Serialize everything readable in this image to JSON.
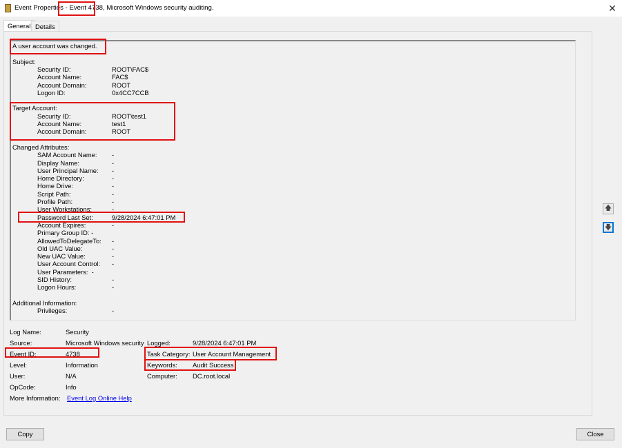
{
  "window": {
    "title": "Event Properties - Event 4738, Microsoft Windows security auditing.",
    "close": "✕"
  },
  "tabs": [
    {
      "label": "General"
    },
    {
      "label": "Details"
    }
  ],
  "description": [
    {
      "text": "A user account was changed."
    },
    {
      "text": ""
    },
    {
      "text": "Subject:"
    },
    {
      "label": "Security ID:",
      "value": "ROOT\\FAC$"
    },
    {
      "label": "Account Name:",
      "value": "FAC$"
    },
    {
      "label": "Account Domain:",
      "value": "ROOT"
    },
    {
      "label": "Logon ID:",
      "value": "0x4CC7CCB"
    },
    {
      "text": ""
    },
    {
      "text": "Target Account:"
    },
    {
      "label": "Security ID:",
      "value": "ROOT\\test1"
    },
    {
      "label": "Account Name:",
      "value": "test1"
    },
    {
      "label": "Account Domain:",
      "value": "ROOT"
    },
    {
      "text": ""
    },
    {
      "text": "Changed Attributes:"
    },
    {
      "label": "SAM Account Name:",
      "value": "-"
    },
    {
      "label": "Display Name:",
      "value": "-"
    },
    {
      "label": "User Principal Name:",
      "value": "-"
    },
    {
      "label": "Home Directory:",
      "value": "-"
    },
    {
      "label": "Home Drive:",
      "value": "-"
    },
    {
      "label": "Script Path:",
      "value": "-"
    },
    {
      "label": "Profile Path:",
      "value": "-"
    },
    {
      "label": "User Workstations:",
      "value": "-"
    },
    {
      "label": "Password Last Set:",
      "value": "9/28/2024 6:47:01 PM"
    },
    {
      "label": "Account Expires:",
      "value": "-"
    },
    {
      "label": "Primary Group ID: -",
      "value": ""
    },
    {
      "label": "AllowedToDelegateTo:",
      "value": "-"
    },
    {
      "label": "Old UAC Value:",
      "value": "-"
    },
    {
      "label": "New UAC Value:",
      "value": "-"
    },
    {
      "label": "User Account Control:",
      "value": "-"
    },
    {
      "label": "User Parameters:  -",
      "value": ""
    },
    {
      "label": "SID History:",
      "value": "-"
    },
    {
      "label": "Logon Hours:",
      "value": "-"
    },
    {
      "text": ""
    },
    {
      "text": "Additional Information:"
    },
    {
      "label": "Privileges:",
      "value": "-"
    }
  ],
  "fields": {
    "log_name": {
      "label": "Log Name:",
      "value": "Security"
    },
    "source": {
      "label": "Source:",
      "value": "Microsoft Windows security"
    },
    "event_id": {
      "label": "Event ID:",
      "value": "4738"
    },
    "level": {
      "label": "Level:",
      "value": "Information"
    },
    "user": {
      "label": "User:",
      "value": "N/A"
    },
    "opcode": {
      "label": "OpCode:",
      "value": "Info"
    },
    "more_info": {
      "label": "More Information:",
      "value": "Event Log Online Help"
    },
    "logged": {
      "label": "Logged:",
      "value": "9/28/2024 6:47:01 PM"
    },
    "task_category": {
      "label": "Task Category:",
      "value": "User Account Management"
    },
    "keywords": {
      "label": "Keywords:",
      "value": "Audit Success"
    },
    "computer": {
      "label": "Computer:",
      "value": "DC.root.local"
    }
  },
  "buttons": {
    "copy": "Copy",
    "close": "Close",
    "up": "🡅",
    "down": "🡇"
  },
  "highlight_color": "#e01010"
}
